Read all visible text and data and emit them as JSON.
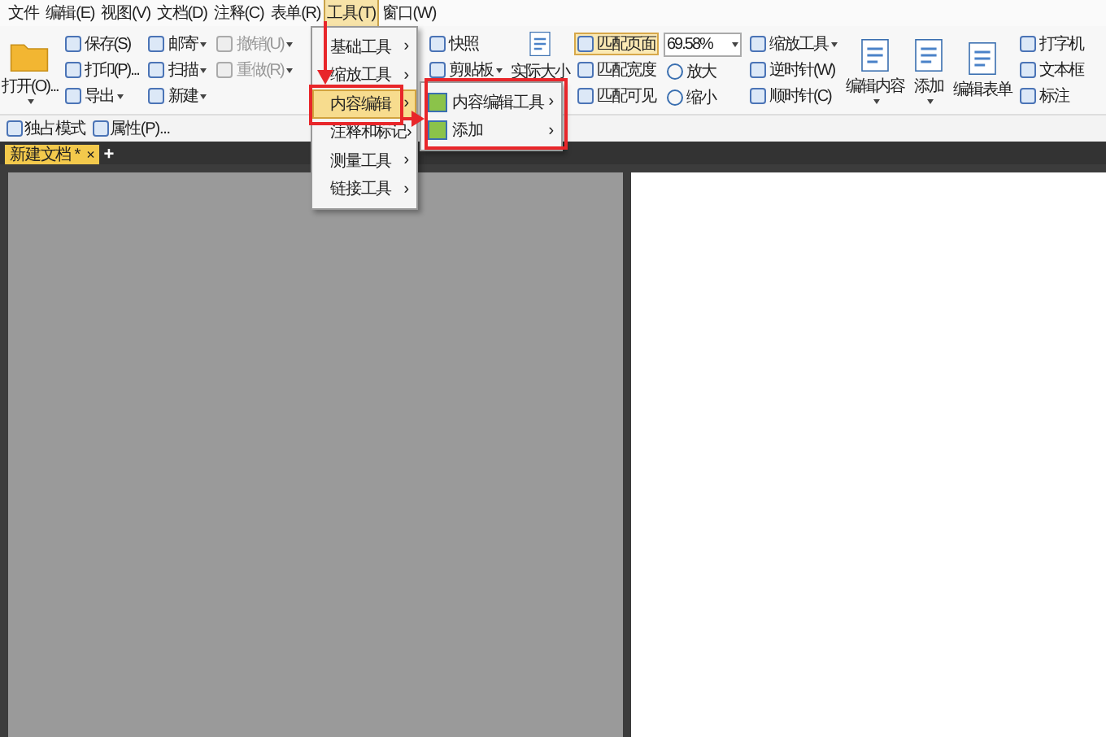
{
  "menu_bar": [
    {
      "label": "文件",
      "selected": false
    },
    {
      "label": "编辑(E)",
      "selected": false
    },
    {
      "label": "视图(V)",
      "selected": false
    },
    {
      "label": "文档(D)",
      "selected": false
    },
    {
      "label": "注释(C)",
      "selected": false
    },
    {
      "label": "表单(R)",
      "selected": false
    },
    {
      "label": "工具(T)",
      "selected": true
    },
    {
      "label": "窗口(W)",
      "selected": false
    }
  ],
  "ribbon": {
    "columns": [
      {
        "kind": "large",
        "label": "打开(O)...",
        "dropdown": true
      },
      {
        "kind": "small",
        "items": [
          {
            "label": "保存(S)",
            "disabled": false,
            "selected": false,
            "dropdown": false
          },
          {
            "label": "打印(P)...",
            "disabled": false,
            "selected": false,
            "dropdown": false
          },
          {
            "label": "导出",
            "disabled": false,
            "selected": false,
            "dropdown": true
          }
        ]
      },
      {
        "kind": "small",
        "items": [
          {
            "label": "邮寄",
            "disabled": false,
            "selected": false,
            "dropdown": true
          },
          {
            "label": "扫描",
            "disabled": false,
            "selected": false,
            "dropdown": true
          },
          {
            "label": "新建",
            "disabled": false,
            "selected": false,
            "dropdown": true
          }
        ]
      },
      {
        "kind": "small",
        "items": [
          {
            "label": "撤销(U)",
            "disabled": true,
            "selected": false,
            "dropdown": true
          },
          {
            "label": "重做(R)",
            "disabled": true,
            "selected": false,
            "dropdown": true
          }
        ]
      },
      {
        "kind": "tools"
      },
      {
        "kind": "small",
        "items": [
          {
            "label": "快照",
            "disabled": false,
            "selected": false,
            "dropdown": false
          },
          {
            "label": "剪贴板",
            "disabled": false,
            "selected": false,
            "dropdown": true
          }
        ]
      },
      {
        "kind": "large",
        "label": "实际大小"
      },
      {
        "kind": "small",
        "items": [
          {
            "label": "匹配页面",
            "disabled": false,
            "selected": true,
            "dropdown": false
          },
          {
            "label": "匹配宽度",
            "disabled": false,
            "selected": false,
            "dropdown": false
          },
          {
            "label": "匹配可见",
            "disabled": false,
            "selected": false,
            "dropdown": false
          }
        ]
      },
      {
        "kind": "zoom",
        "value": "69.58%",
        "items": [
          {
            "label": "放大"
          },
          {
            "label": "缩小"
          }
        ]
      },
      {
        "kind": "small",
        "items": [
          {
            "label": "缩放工具",
            "disabled": false,
            "selected": false,
            "dropdown": true
          },
          {
            "label": "逆时针(W)",
            "disabled": false,
            "selected": false,
            "dropdown": false
          },
          {
            "label": "顺时针(C)",
            "disabled": false,
            "selected": false,
            "dropdown": false
          }
        ]
      },
      {
        "kind": "large",
        "label": "编辑内容",
        "dropdown": true
      },
      {
        "kind": "large",
        "label": "添加",
        "dropdown": true
      },
      {
        "kind": "large",
        "label": "编辑表单",
        "dropdown": false
      },
      {
        "kind": "small",
        "items": [
          {
            "label": "打字机",
            "disabled": false,
            "selected": false,
            "dropdown": false
          },
          {
            "label": "文本框",
            "disabled": false,
            "selected": false,
            "dropdown": false
          },
          {
            "label": "标注",
            "disabled": false,
            "selected": false,
            "dropdown": false
          }
        ]
      }
    ]
  },
  "quick_bar": [
    {
      "label": "独占模式"
    },
    {
      "label": "属性(P)..."
    }
  ],
  "tabs": [
    {
      "label": "新建文档 *",
      "selected": true,
      "close": "×"
    }
  ],
  "new_tab": "+",
  "tools_menu": [
    {
      "label": "基础工具",
      "selected": false,
      "submenu": "›"
    },
    {
      "label": "缩放工具",
      "selected": false,
      "submenu": "›"
    },
    {
      "label": "内容编辑",
      "selected": true,
      "submenu": "›"
    },
    {
      "label": "注释和标记",
      "selected": false,
      "submenu": "›"
    },
    {
      "label": "测量工具",
      "selected": false,
      "submenu": "›"
    },
    {
      "label": "链接工具",
      "selected": false,
      "submenu": "›"
    }
  ],
  "content_edit_submenu": [
    {
      "label": "内容编辑工具",
      "submenu": "›"
    },
    {
      "label": "添加",
      "submenu": "›"
    }
  ]
}
